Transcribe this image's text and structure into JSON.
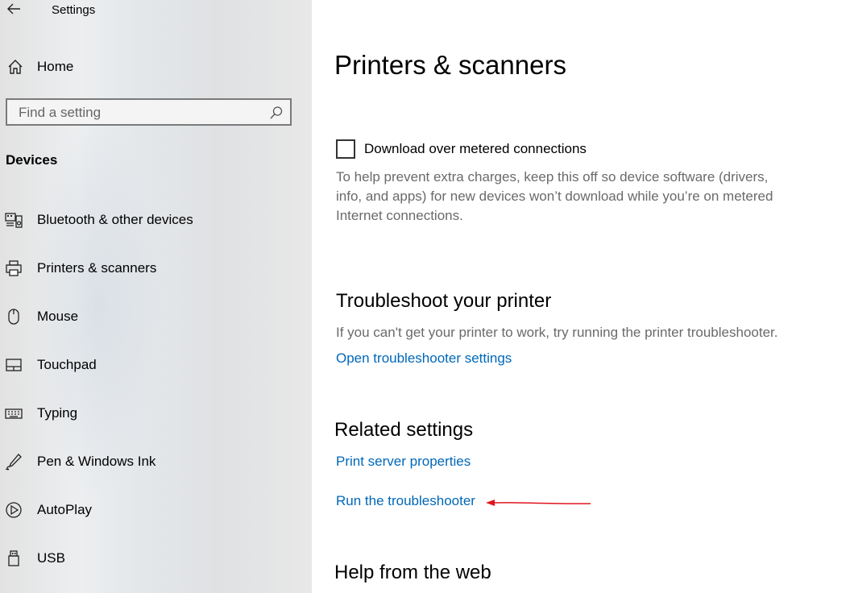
{
  "window": {
    "title": "Settings"
  },
  "sidebar": {
    "home_label": "Home",
    "search": {
      "placeholder": "Find a setting"
    },
    "section_title": "Devices",
    "items": [
      {
        "label": "Bluetooth & other devices",
        "icon": "bluetooth-devices-icon"
      },
      {
        "label": "Printers & scanners",
        "icon": "printer-icon"
      },
      {
        "label": "Mouse",
        "icon": "mouse-icon"
      },
      {
        "label": "Touchpad",
        "icon": "touchpad-icon"
      },
      {
        "label": "Typing",
        "icon": "keyboard-icon"
      },
      {
        "label": "Pen & Windows Ink",
        "icon": "pen-icon"
      },
      {
        "label": "AutoPlay",
        "icon": "autoplay-icon"
      },
      {
        "label": "USB",
        "icon": "usb-icon"
      }
    ]
  },
  "main": {
    "page_title": "Printers & scanners",
    "metered": {
      "label": "Download over metered connections",
      "checked": false,
      "description": "To help prevent extra charges, keep this off so device software (drivers, info, and apps) for new devices won’t download while you’re on metered Internet connections."
    },
    "troubleshoot": {
      "heading": "Troubleshoot your printer",
      "description": "If you can't get your printer to work, try running the printer troubleshooter.",
      "link": "Open troubleshooter settings"
    },
    "related": {
      "heading": "Related settings",
      "links": [
        "Print server properties",
        "Run the troubleshooter"
      ]
    },
    "help": {
      "heading": "Help from the web"
    }
  },
  "colors": {
    "link": "#0067b8",
    "annotation_arrow": "#e0141e",
    "muted_text": "#6a6a6a"
  }
}
